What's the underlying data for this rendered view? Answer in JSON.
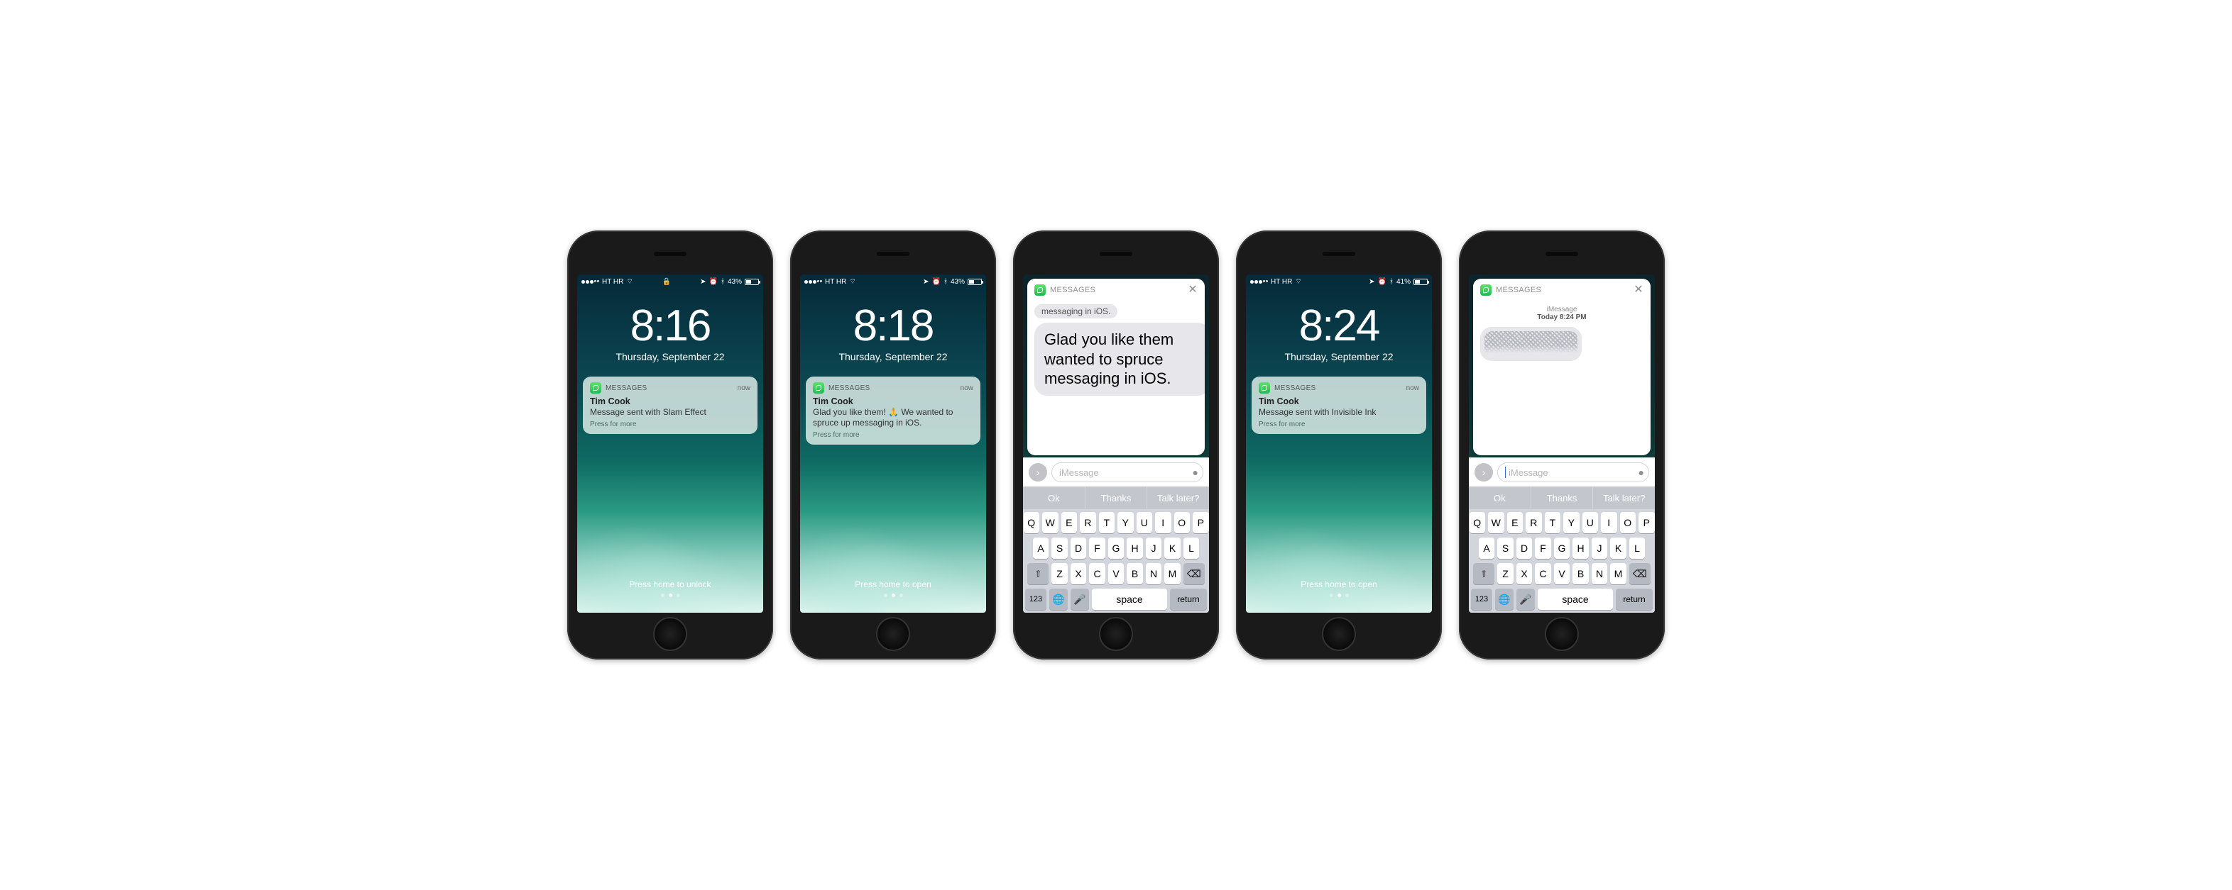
{
  "status": {
    "carrier": "HT HR",
    "indicators": "⟐ ⏰ ✱",
    "locked_glyph": "🔒",
    "nav_glyph": "➤"
  },
  "keyboard": {
    "row1": [
      "Q",
      "W",
      "E",
      "R",
      "T",
      "Y",
      "U",
      "I",
      "O",
      "P"
    ],
    "row2": [
      "A",
      "S",
      "D",
      "F",
      "G",
      "H",
      "J",
      "K",
      "L"
    ],
    "row3": [
      "Z",
      "X",
      "C",
      "V",
      "B",
      "N",
      "M"
    ],
    "nums": "123",
    "space": "space",
    "return": "return",
    "shift": "⇧",
    "delete": "⌫",
    "globe": "🌐",
    "mic": "🎤"
  },
  "quick_replies": [
    "Ok",
    "Thanks",
    "Talk later?"
  ],
  "messages_label": "MESSAGES",
  "input_placeholder": "iMessage",
  "screens": [
    {
      "battery": "43%",
      "time": "8:16",
      "date": "Thursday, September 22",
      "notif": {
        "when": "now",
        "sender": "Tim Cook",
        "body": "Message sent with Slam Effect",
        "more": "Press for more"
      },
      "hint": "Press home to unlock"
    },
    {
      "battery": "43%",
      "time": "8:18",
      "date": "Thursday, September 22",
      "notif": {
        "when": "now",
        "sender": "Tim Cook",
        "body": "Glad you like them! 🙏 We wanted to spruce up messaging in iOS.",
        "more": "Press for more"
      },
      "hint": "Press home to open"
    },
    {
      "card": {
        "prev": "messaging in iOS.",
        "big": "Glad you like them wanted to spruce messaging in iOS."
      }
    },
    {
      "battery": "41%",
      "time": "8:24",
      "date": "Thursday, September 22",
      "notif": {
        "when": "now",
        "sender": "Tim Cook",
        "body": "Message sent with Invisible Ink",
        "more": "Press for more"
      },
      "hint": "Press home to open"
    },
    {
      "card": {
        "ts_label": "iMessage",
        "ts_time": "Today 8:24 PM"
      }
    }
  ]
}
